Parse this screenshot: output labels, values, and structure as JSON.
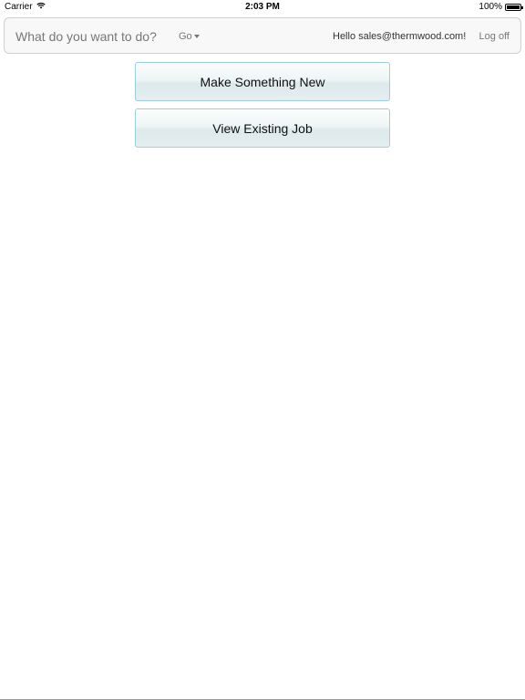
{
  "status_bar": {
    "carrier": "Carrier",
    "time": "2:03 PM",
    "battery_percent": "100%",
    "battery_level": 1.0
  },
  "navbar": {
    "brand": "What do you want to do?",
    "go_menu": "Go",
    "greeting": "Hello sales@thermwood.com!",
    "logoff": "Log off"
  },
  "actions": {
    "make_new": "Make Something New",
    "view_existing": "View Existing Job"
  },
  "colors": {
    "button_border": "#9ccfdc",
    "navbar_bg": "#f8f8f8"
  }
}
